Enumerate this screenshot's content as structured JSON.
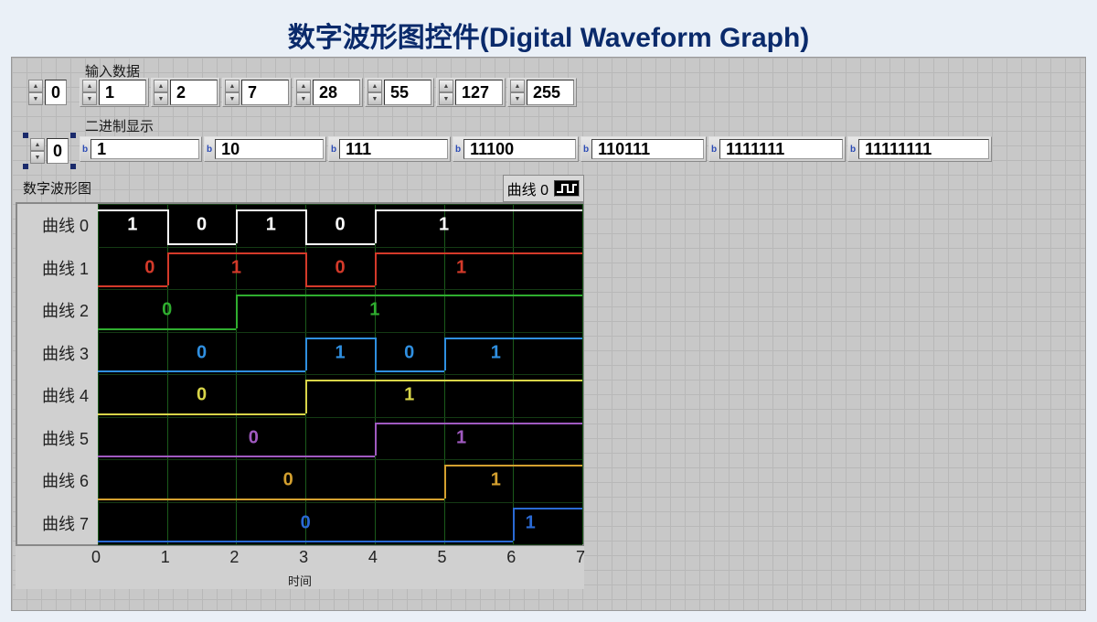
{
  "title": "数字波形图控件(Digital Waveform Graph)",
  "input_label": "输入数据",
  "input_index": "0",
  "input_values": [
    "1",
    "2",
    "7",
    "28",
    "55",
    "127",
    "255"
  ],
  "binary_label": "二进制显示",
  "binary_index": "0",
  "binary_values": [
    "1",
    "10",
    "111",
    "11100",
    "110111",
    "1111111",
    "11111111"
  ],
  "graph_label": "数字波形图",
  "legend_label": "曲线 0",
  "y_labels": [
    "曲线 0",
    "曲线 1",
    "曲线 2",
    "曲线 3",
    "曲线 4",
    "曲线 5",
    "曲线 6",
    "曲线 7"
  ],
  "x_ticks": [
    "0",
    "1",
    "2",
    "3",
    "4",
    "5",
    "6",
    "7"
  ],
  "x_axis_label": "时间",
  "chart_data": {
    "type": "digital-waveform",
    "xlabel": "时间",
    "x_range": [
      0,
      7
    ],
    "curves": [
      {
        "name": "曲线 0",
        "color": "#ffffff",
        "labels": [
          {
            "x": 0.5,
            "v": "1"
          },
          {
            "x": 1.5,
            "v": "0"
          },
          {
            "x": 2.5,
            "v": "1"
          },
          {
            "x": 3.5,
            "v": "0"
          },
          {
            "x": 5,
            "v": "1"
          }
        ]
      },
      {
        "name": "曲线 1",
        "color": "#d43a2a",
        "labels": [
          {
            "x": 0.75,
            "v": "0"
          },
          {
            "x": 2,
            "v": "1"
          },
          {
            "x": 3.5,
            "v": "0"
          },
          {
            "x": 5.25,
            "v": "1"
          }
        ]
      },
      {
        "name": "曲线 2",
        "color": "#2fae2f",
        "labels": [
          {
            "x": 1,
            "v": "0"
          },
          {
            "x": 4,
            "v": "1"
          }
        ]
      },
      {
        "name": "曲线 3",
        "color": "#2f8fe0",
        "labels": [
          {
            "x": 1.5,
            "v": "0"
          },
          {
            "x": 3.5,
            "v": "1"
          },
          {
            "x": 4.5,
            "v": "0"
          },
          {
            "x": 5.75,
            "v": "1"
          }
        ]
      },
      {
        "name": "曲线 4",
        "color": "#d8d548",
        "labels": [
          {
            "x": 1.5,
            "v": "0"
          },
          {
            "x": 4.5,
            "v": "1"
          }
        ]
      },
      {
        "name": "曲线 5",
        "color": "#a05ac0",
        "labels": [
          {
            "x": 2.25,
            "v": "0"
          },
          {
            "x": 5.25,
            "v": "1"
          }
        ]
      },
      {
        "name": "曲线 6",
        "color": "#d4a02f",
        "labels": [
          {
            "x": 2.75,
            "v": "0"
          },
          {
            "x": 5.75,
            "v": "1"
          }
        ]
      },
      {
        "name": "曲线 7",
        "color": "#2a6ad4",
        "labels": [
          {
            "x": 3,
            "v": "0"
          },
          {
            "x": 6.25,
            "v": "1"
          }
        ]
      }
    ],
    "transitions": [
      {
        "curve": 0,
        "edges": [
          1,
          2,
          3,
          4
        ]
      },
      {
        "curve": 1,
        "edges": [
          1,
          3,
          4
        ]
      },
      {
        "curve": 2,
        "edges": [
          2
        ]
      },
      {
        "curve": 3,
        "edges": [
          3,
          4,
          5
        ]
      },
      {
        "curve": 4,
        "edges": [
          3
        ]
      },
      {
        "curve": 5,
        "edges": [
          4
        ]
      },
      {
        "curve": 6,
        "edges": [
          5
        ]
      },
      {
        "curve": 7,
        "edges": [
          6
        ]
      }
    ]
  }
}
